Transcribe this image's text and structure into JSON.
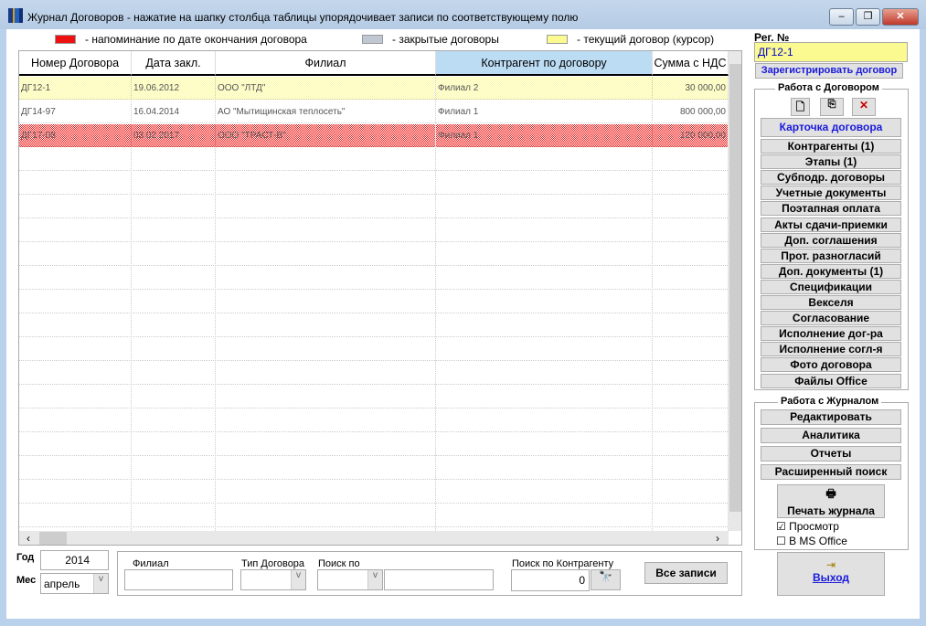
{
  "window": {
    "title": "Журнал Договоров - нажатие на шапку столбца таблицы упорядочивает записи по соответствующему полю",
    "min": "–",
    "max": "❐",
    "close": "✕"
  },
  "legend": [
    {
      "label": "- напоминание по дате окончания договора",
      "color": "#ee1111"
    },
    {
      "label": "- закрытые договоры",
      "color": "#c0c8d4"
    },
    {
      "label": "- текущий договор (курсор)",
      "color": "#fafa90"
    }
  ],
  "table": {
    "columns": [
      "Номер Договора",
      "Дата закл.",
      "Филиал",
      "Контрагент по договору",
      "Сумма с НДС"
    ],
    "rows": [
      [
        "ДГ12-1",
        "19.06.2012",
        "ООО \"ЛТД\"",
        "Филиал 2",
        "30 000,00"
      ],
      [
        "ДГ14-97",
        "16.04.2014",
        "АО \"Мытищинская теплосеть\"",
        "Филиал 1",
        "800 000,00"
      ],
      [
        "ДГ17-08",
        "03.02.2017",
        "ООО \"ТРАСТ-В\"",
        "Филиал 1",
        "120 000,00"
      ]
    ]
  },
  "reg": {
    "label": "Рег. №",
    "value": "ДГ12-1",
    "register": "Зарегистрировать договор"
  },
  "contract": {
    "title": "Работа с Договором",
    "card": "Карточка договора",
    "items": [
      "Контрагенты (1)",
      "Этапы (1)",
      "Субподр. договоры",
      "Учетные документы",
      "Поэтапная оплата",
      "Акты сдачи-приемки",
      "Доп. соглашения",
      "Прот. разногласий",
      "Доп. документы (1)",
      "Спецификации",
      "Векселя",
      "Согласование",
      "Исполнение дог-ра",
      "Исполнение согл-я",
      "Фото договора",
      "Файлы Office"
    ]
  },
  "journal": {
    "title": "Работа с Журналом",
    "items": [
      "Редактировать",
      "Аналитика",
      "Отчеты",
      "Расширенный поиск"
    ],
    "print": "Печать журнала",
    "preview": "Просмотр",
    "msoffice": "В MS Office"
  },
  "exit": "Выход",
  "filters": {
    "year_label": "Год",
    "year": "2014",
    "month_label": "Мес",
    "month": "апрель",
    "branch": "Филиал",
    "type": "Тип Договора",
    "search_by": "Поиск по",
    "search_contractor": "Поиск по Контрагенту",
    "count": "0",
    "all": "Все записи"
  }
}
